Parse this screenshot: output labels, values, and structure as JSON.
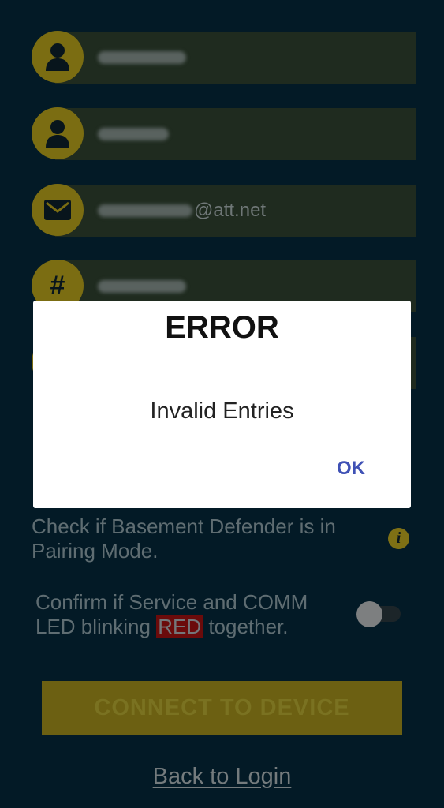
{
  "form": {
    "fields": [
      {
        "icon": "user-icon",
        "value_suffix": ""
      },
      {
        "icon": "user-icon",
        "value_suffix": ""
      },
      {
        "icon": "envelope-icon",
        "value_suffix": "@att.net"
      },
      {
        "icon": "hash-icon",
        "icon_glyph": "#",
        "value_suffix": ""
      }
    ]
  },
  "pairing": {
    "check_text": "Check if Basement Defender is in Pairing Mode.",
    "info_glyph": "i",
    "confirm_text_before": "Confirm if Service and COMM LED blinking ",
    "confirm_red_word": "RED",
    "confirm_text_after": " together.",
    "toggle_on": false
  },
  "connect_button": {
    "label": "CONNECT TO DEVICE"
  },
  "back_link": {
    "label": "Back to Login"
  },
  "dialog": {
    "title": "ERROR",
    "message": "Invalid Entries",
    "ok_label": "OK"
  },
  "colors": {
    "background": "#031a26",
    "accent_yellow": "#7b6d12",
    "dialog_button": "#3f51b5"
  }
}
